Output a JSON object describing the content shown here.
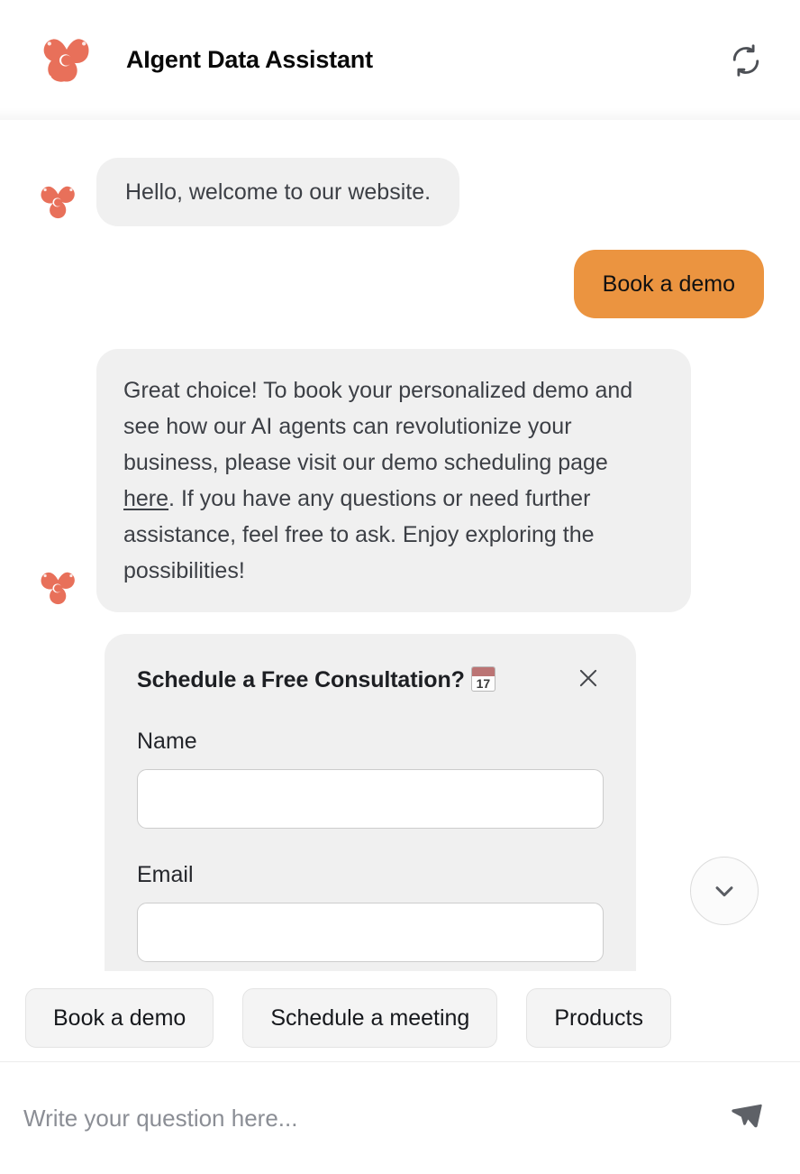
{
  "header": {
    "title": "AIgent Data Assistant",
    "logo_icon": "aigent-star-logo",
    "refresh_icon": "refresh-icon",
    "refresh_label": "Restart conversation"
  },
  "conversation": {
    "messages": [
      {
        "sender": "bot",
        "text": "Hello, welcome to our website.",
        "avatar_icon": "aigent-star-logo"
      },
      {
        "sender": "user",
        "text": "Book a demo"
      },
      {
        "sender": "bot",
        "text_before_link": "Great choice! To book your personalized demo and see how our AI agents can revolutionize your business, please visit our demo scheduling page ",
        "link_text": "here",
        "text_after_link": ". If you have any questions or need further assistance, feel free to ask. Enjoy exploring the possibilities!",
        "avatar_icon": "aigent-star-logo"
      }
    ]
  },
  "form_card": {
    "title": "Schedule a Free Consultation?",
    "title_emoji": "calendar-emoji",
    "calendar_day": "17",
    "close_icon": "close-icon",
    "fields": [
      {
        "label": "Name",
        "value": "",
        "placeholder": ""
      },
      {
        "label": "Email",
        "value": "",
        "placeholder": ""
      }
    ]
  },
  "scroll_button": {
    "icon": "chevron-down-icon",
    "label": "Scroll to bottom"
  },
  "quick_replies": {
    "items": [
      {
        "label": "Book a demo"
      },
      {
        "label": "Schedule a meeting"
      },
      {
        "label": "Products"
      }
    ]
  },
  "composer": {
    "value": "",
    "placeholder": "Write your question here...",
    "send_icon": "send-icon"
  },
  "colors": {
    "brand_logo": "#e8705a",
    "user_bubble": "#eb9440",
    "bot_bubble": "#f0f0f0",
    "card_bg": "#f0f0f0",
    "chip_bg": "#f4f4f4",
    "text_primary": "#3c3f45"
  }
}
